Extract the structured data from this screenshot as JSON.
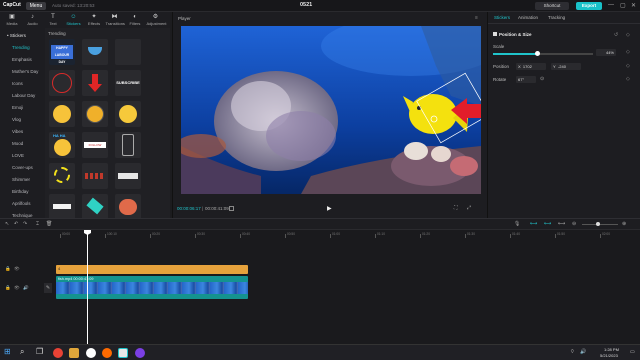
{
  "titlebar": {
    "logo": "CapCut",
    "menu": "Menu",
    "autosave": "Auto saved: 13:20:53",
    "project_name": "0521",
    "shortcut": "Shortcut",
    "export": "Export",
    "minimize": "—",
    "maximize": "▢",
    "close": "✕"
  },
  "toolbar": {
    "items": [
      {
        "label": "Media",
        "icon": "media-icon",
        "glyph": "▣"
      },
      {
        "label": "Audio",
        "icon": "audio-icon",
        "glyph": "♪"
      },
      {
        "label": "Text",
        "icon": "text-icon",
        "glyph": "T"
      },
      {
        "label": "Stickers",
        "icon": "sticker-icon",
        "glyph": "☺"
      },
      {
        "label": "Effects",
        "icon": "effects-icon",
        "glyph": "✦"
      },
      {
        "label": "Transitions",
        "icon": "transitions-icon",
        "glyph": "⧓"
      },
      {
        "label": "Filters",
        "icon": "filters-icon",
        "glyph": "◐"
      },
      {
        "label": "Adjustment",
        "icon": "adjustment-icon",
        "glyph": "⚙"
      }
    ]
  },
  "categories": {
    "header": "• Stickers",
    "items": [
      "Trending",
      "Emphasis",
      "Mother's Day",
      "Icons",
      "Labour Day",
      "Emoji",
      "Vlog",
      "Vibes",
      "Mood",
      "LOVE",
      "Cover-ups",
      "Shimmer",
      "Birthday",
      "Aprilfools",
      "Technique"
    ]
  },
  "stickers": {
    "section_label": "Trending",
    "items": [
      {
        "name": "labour-day-sticker",
        "text": "HAPPY LABOUR DAY"
      },
      {
        "name": "bowl-sticker",
        "text": ""
      },
      {
        "name": "empty-sticker",
        "text": ""
      },
      {
        "name": "red-circle-sticker",
        "text": ""
      },
      {
        "name": "red-arrow-sticker",
        "text": ""
      },
      {
        "name": "subscribe-sticker",
        "text": "SUBSCRIBE"
      },
      {
        "name": "kiss-emoji-sticker",
        "text": ""
      },
      {
        "name": "angry-emoji-sticker",
        "text": ""
      },
      {
        "name": "surprised-emoji-sticker",
        "text": ""
      },
      {
        "name": "haha-emoji-sticker",
        "text": "HA HA"
      },
      {
        "name": "follow-sticker",
        "text": "FOLLOW"
      },
      {
        "name": "phone-frame-sticker",
        "text": ""
      },
      {
        "name": "sparkle-sticker",
        "text": ""
      },
      {
        "name": "red-dots-sticker",
        "text": ""
      },
      {
        "name": "label-sticker",
        "text": ""
      },
      {
        "name": "blank-sticker",
        "text": ""
      },
      {
        "name": "teal-sticker",
        "text": ""
      },
      {
        "name": "brain-sticker",
        "text": ""
      }
    ]
  },
  "player": {
    "title": "Player",
    "current_time": "00:00:06:17",
    "total_time": "00:00:41:09",
    "play_icon": "▶"
  },
  "right_panel": {
    "tabs": [
      "Stickers",
      "Animation",
      "Tracking"
    ],
    "section_title": "Position & Size",
    "scale_label": "Scale",
    "scale_value": "44%",
    "scale_fraction": 0.44,
    "position_label": "Position",
    "position_x_prefix": "X",
    "position_x": "1702",
    "position_y_prefix": "Y",
    "position_y": "-240",
    "rotate_label": "Rotate",
    "rotate_value": "67°"
  },
  "timeline": {
    "ruler_labels": [
      "00:00",
      "100:10",
      "00:20",
      "00:30",
      "00:40",
      "00:50",
      "01:00",
      "01:10",
      "01:20",
      "01:30",
      "01:40",
      "01:50",
      "02:00"
    ],
    "video_clip_label": "fish.mp4  00:00:41:09",
    "sticker_clip_label": "4"
  },
  "taskbar": {
    "time": "1:28 PM",
    "date": "5/21/2023"
  },
  "colors": {
    "accent": "#20c4cb",
    "sticker_clip": "#e6a23c",
    "video_clip": "#14938f"
  }
}
